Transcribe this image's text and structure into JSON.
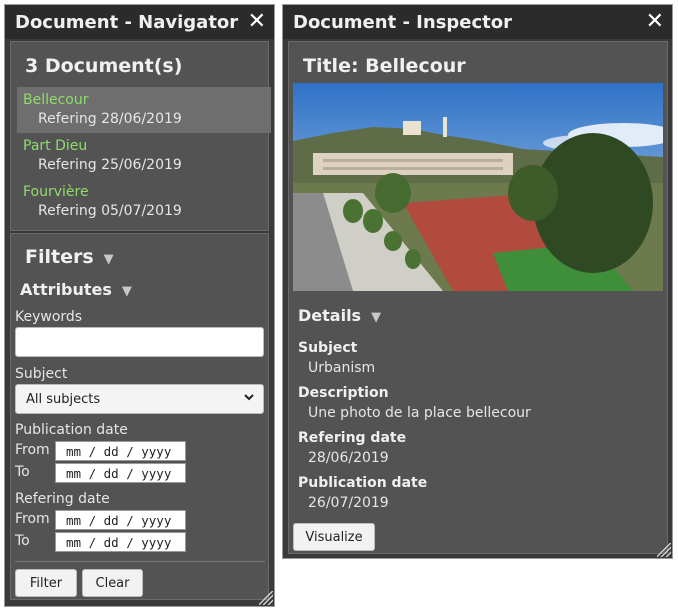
{
  "navigator": {
    "title": "Document - Navigator",
    "close": "✕",
    "doc_count": "3 Document(s)",
    "documents": [
      {
        "name": "Bellecour",
        "ref": "Refering 28/06/2019"
      },
      {
        "name": "Part Dieu",
        "ref": "Refering 25/06/2019"
      },
      {
        "name": "Fourvière",
        "ref": "Refering 05/07/2019"
      }
    ],
    "filters": {
      "title": "Filters",
      "attributes_title": "Attributes",
      "keywords_label": "Keywords",
      "keywords_value": "",
      "subject_label": "Subject",
      "subject_value": "All subjects",
      "pub_date_label": "Publication date",
      "ref_date_label": "Refering date",
      "from_label": "From",
      "to_label": "To",
      "date_placeholder": "mm / dd / yyyy",
      "filter_button": "Filter",
      "clear_button": "Clear"
    }
  },
  "inspector": {
    "title": "Document - Inspector",
    "close": "✕",
    "doc_title": "Title: Bellecour",
    "details_title": "Details",
    "subject_label": "Subject",
    "subject_value": "Urbanism",
    "description_label": "Description",
    "description_value": "Une photo de la place bellecour",
    "ref_date_label": "Refering date",
    "ref_date_value": "28/06/2019",
    "pub_date_label": "Publication date",
    "pub_date_value": "26/07/2019",
    "visualize_button": "Visualize"
  },
  "icons": {
    "close": "close-icon",
    "collapse": "triangle-down-icon",
    "dropdown": "chevron-down-icon",
    "resize": "resize-handle-icon"
  },
  "colors": {
    "window_bg": "#3a3a3a",
    "panel_bg": "#535353",
    "doc_name": "#8fdc6a",
    "selected_row": "#6e6e6e"
  }
}
